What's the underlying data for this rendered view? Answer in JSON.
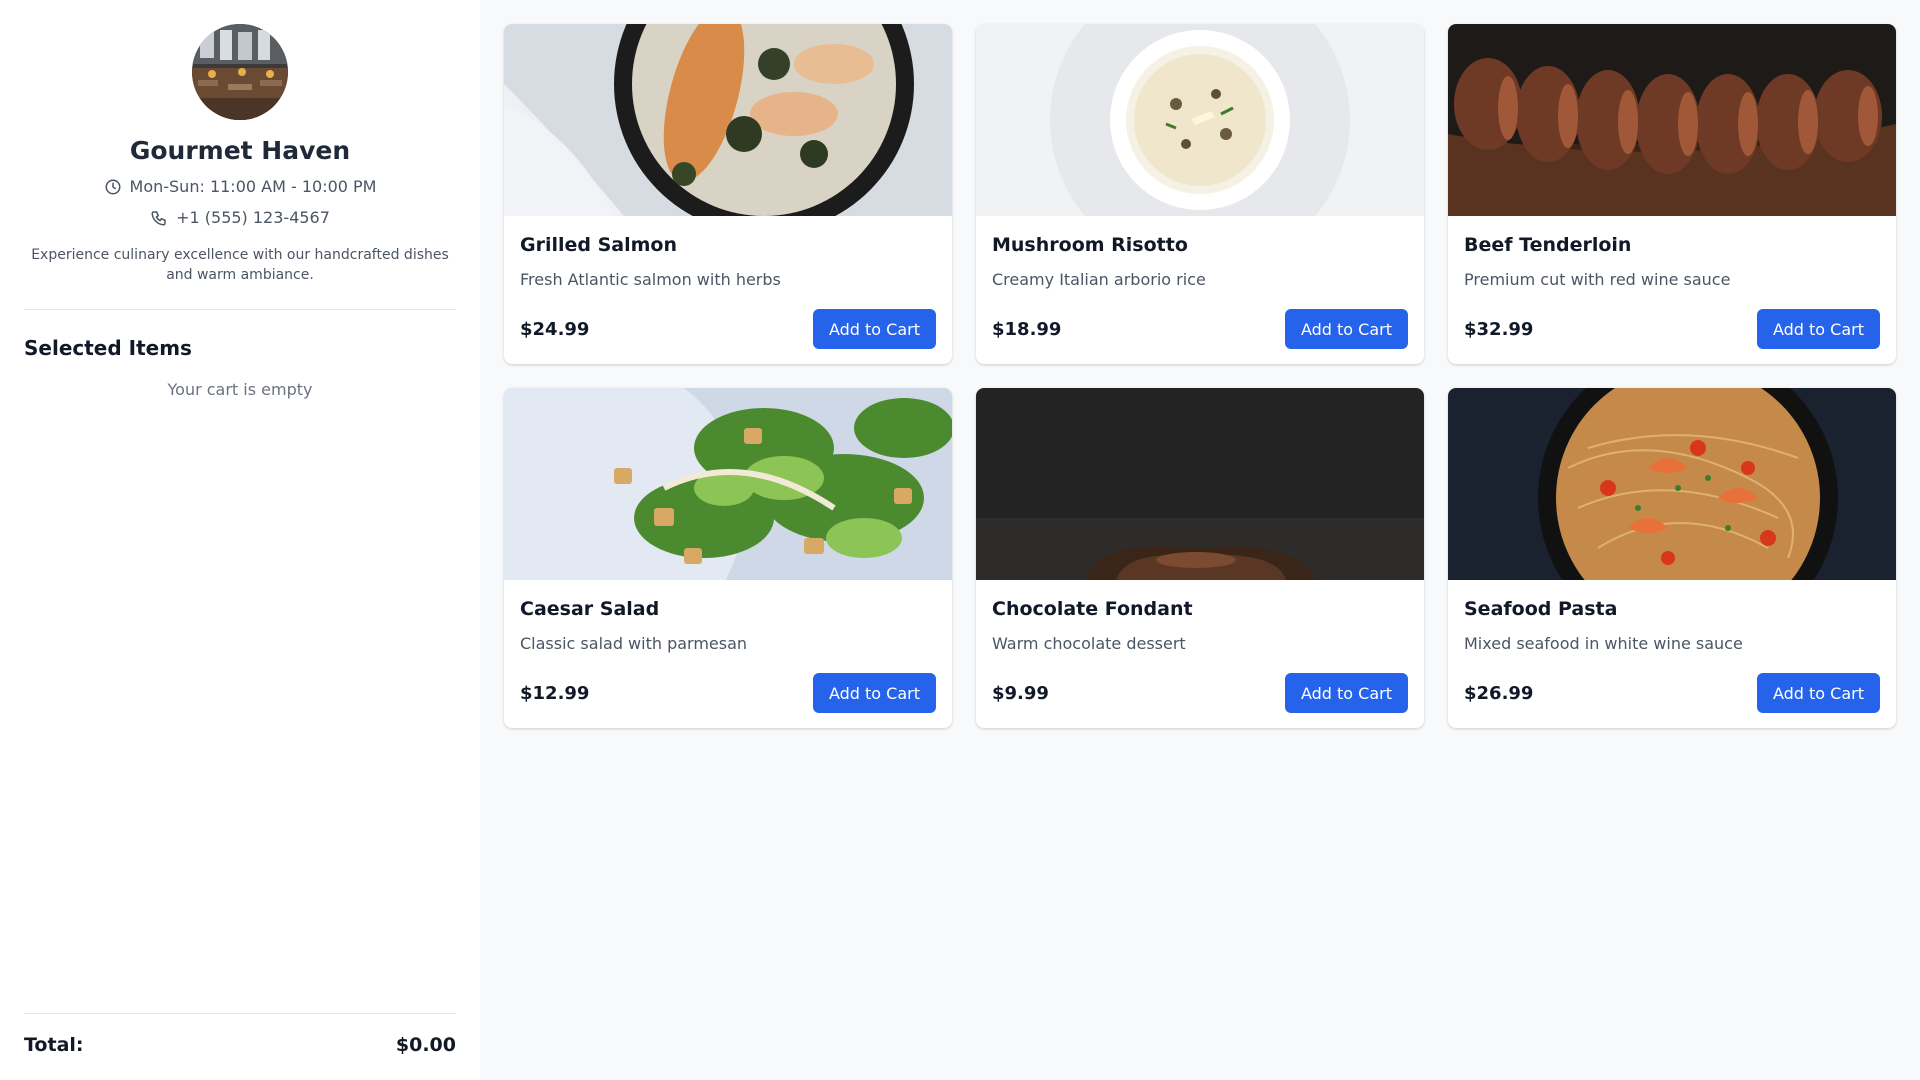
{
  "restaurant": {
    "name": "Gourmet Haven",
    "hours": "Mon-Sun: 11:00 AM - 10:00 PM",
    "phone": "+1 (555) 123-4567",
    "description": "Experience culinary excellence with our handcrafted dishes and warm ambiance.",
    "avatar_icon": "restaurant-photo"
  },
  "cart": {
    "title": "Selected Items",
    "empty_text": "Your cart is empty",
    "total_label": "Total:",
    "total_value": "$0.00"
  },
  "colors": {
    "accent": "#2563eb",
    "sidebar_bg": "#ffffff",
    "page_bg": "#f8f9fb"
  },
  "menu": {
    "button_label": "Add to Cart",
    "items": [
      {
        "name": "Grilled Salmon",
        "description": "Fresh Atlantic salmon with herbs",
        "price": "$24.99"
      },
      {
        "name": "Mushroom Risotto",
        "description": "Creamy Italian arborio rice",
        "price": "$18.99"
      },
      {
        "name": "Beef Tenderloin",
        "description": "Premium cut with red wine sauce",
        "price": "$32.99"
      },
      {
        "name": "Caesar Salad",
        "description": "Classic salad with parmesan",
        "price": "$12.99"
      },
      {
        "name": "Chocolate Fondant",
        "description": "Warm chocolate dessert",
        "price": "$9.99"
      },
      {
        "name": "Seafood Pasta",
        "description": "Mixed seafood in white wine sauce",
        "price": "$26.99"
      }
    ]
  }
}
